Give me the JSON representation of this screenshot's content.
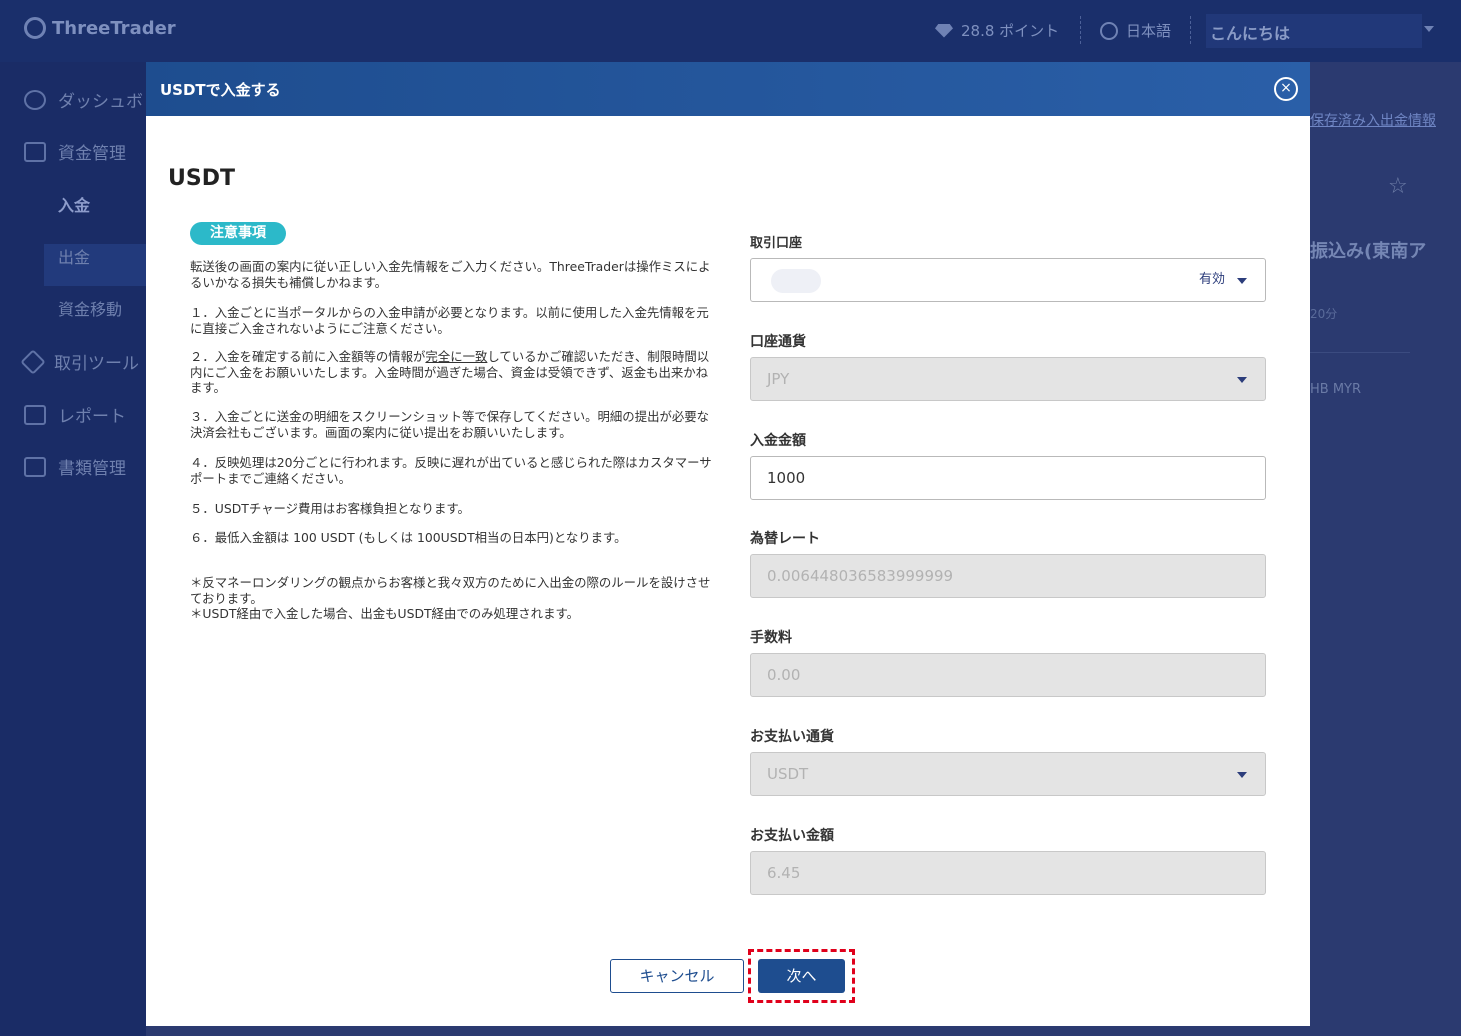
{
  "app": {
    "logo_text": "ThreeTrader",
    "points": "28.8 ポイント",
    "language": "日本語",
    "greeting": "こんにちは"
  },
  "sidebar": {
    "items": [
      {
        "label": "ダッシュボ"
      },
      {
        "label": "資金管理"
      },
      {
        "label": "入金"
      },
      {
        "label": "出金"
      },
      {
        "label": "資金移動"
      },
      {
        "label": "取引ツール"
      },
      {
        "label": "レポート"
      },
      {
        "label": "書類管理"
      }
    ]
  },
  "background": {
    "link": "保存済み入出金情報",
    "title": "振込み(東南ア",
    "chip": "20分",
    "currencies": "HB MYR"
  },
  "modal": {
    "title": "USDTで入金する",
    "close_icon": "×",
    "section_title": "USDT",
    "notice_badge": "注意事項",
    "notice": {
      "intro": "転送後の画面の案内に従い正しい入金先情報をご入力ください。ThreeTraderは操作ミスによるいかなる損失も補償しかねます。",
      "p1": "１．入金ごとに当ポータルからの入金申請が必要となります。以前に使用した入金先情報を元に直接ご入金されないようにご注意ください。",
      "p2_a": "２．入金を確定する前に入金額等の情報が",
      "p2_u": "完全に一致",
      "p2_b": "しているかご確認いただき、制限時間以内にご入金をお願いいたします。入金時間が過ぎた場合、資金は受領できず、返金も出来かねます。",
      "p3": "３．入金ごとに送金の明細をスクリーンショット等で保存してください。明細の提出が必要な決済会社もございます。画面の案内に従い提出をお願いいたします。",
      "p4": "４．反映処理は20分ごとに行われます。反映に遅れが出ていると感じられた際はカスタマーサポートまでご連絡ください。",
      "p5": "５．USDTチャージ費用はお客様負担となります。",
      "p6": "６．最低入金額は 100 USDT (もしくは 100USDT相当の日本円)となります。",
      "n1": "＊反マネーロンダリングの観点からお客様と我々双方のために入出金の際のルールを設けさせております。",
      "n2": "＊USDT経由で入金した場合、出金もUSDT経由でのみ処理されます。"
    },
    "form": {
      "account_label": "取引口座",
      "account_status": "有効",
      "currency_label": "口座通貨",
      "currency_value": "JPY",
      "amount_label": "入金金額",
      "amount_value": "1000",
      "rate_label": "為替レート",
      "rate_value": "0.006448036583999999",
      "fee_label": "手数料",
      "fee_value": "0.00",
      "pay_currency_label": "お支払い通貨",
      "pay_currency_value": "USDT",
      "pay_amount_label": "お支払い金額",
      "pay_amount_value": "6.45"
    },
    "buttons": {
      "cancel": "キャンセル",
      "next": "次へ"
    }
  },
  "colors": {
    "header": "#1e4d8f",
    "badge": "#2cb9c9",
    "highlight": "#e0001b"
  }
}
